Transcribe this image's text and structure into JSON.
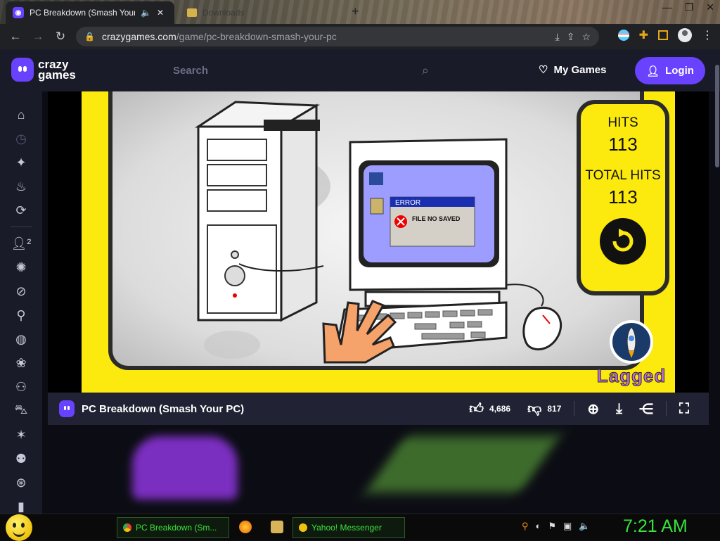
{
  "browser": {
    "active_tab_title": "PC Breakdown (Smash Your PC)",
    "inactive_tab_title": "Downloads",
    "url_host": "crazygames.com",
    "url_path": "/game/pc-breakdown-smash-your-pc"
  },
  "site": {
    "logo_line1": "crazy",
    "logo_line2": "games",
    "search_placeholder": "Search",
    "my_games_label": "My Games",
    "login_label": "Login"
  },
  "sidebar": {
    "items": [
      "home-icon",
      "clock-icon",
      "sparkle-icon",
      "flame-icon",
      "refresh-icon",
      "multiplayer-icon",
      "explosion-icon",
      "compass-icon",
      "joystick-icon",
      "basketball-icon",
      "flower-icon",
      "bicycle-icon",
      "car-icon",
      "star-burst-icon",
      "controller-icon",
      "steering-wheel-icon",
      "door-icon"
    ]
  },
  "game": {
    "error_title": "ERROR",
    "error_message": "FILE NO SAVED",
    "hits_label": "HITS",
    "hits_value": "113",
    "total_hits_label": "TOTAL HITS",
    "total_hits_value": "113",
    "sponsor": "Lagged"
  },
  "gamebar": {
    "title": "PC Breakdown (Smash Your PC)",
    "likes": "4,686",
    "dislikes": "817"
  },
  "taskbar": {
    "task1": "PC Breakdown (Sm...",
    "task2": "Yahoo! Messenger",
    "clock": "7:21 AM"
  },
  "colors": {
    "brand_purple": "#6842ff",
    "game_yellow": "#fce90e",
    "taskbar_green": "#38e33a"
  }
}
